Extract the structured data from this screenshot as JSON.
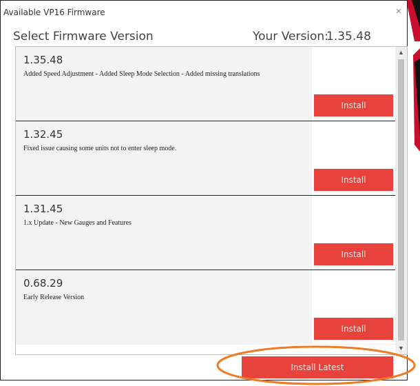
{
  "window": {
    "title": "Available VP16 Firmware",
    "close_glyph": "×"
  },
  "header": {
    "title": "Select Firmware Version",
    "your_version_label": "Your Version:",
    "your_version_value": "1.35.48"
  },
  "firmware_list": [
    {
      "version": "1.35.48",
      "description": "Added Speed Adjustment - Added Sleep Mode Selection - Added missing translations",
      "install_label": "Install"
    },
    {
      "version": "1.32.45",
      "description": "Fixed issue causing some units not to enter sleep mode.",
      "install_label": "Install"
    },
    {
      "version": "1.31.45",
      "description": "1.x Update - New Gauges and Features",
      "install_label": "Install"
    },
    {
      "version": "0.68.29",
      "description": "Early Release Version",
      "install_label": "Install"
    }
  ],
  "footer": {
    "install_latest_label": "Install Latest"
  },
  "colors": {
    "accent": "#e8423c",
    "highlight": "#f07b22"
  },
  "icons": {
    "close": "close-icon",
    "scroll_up": "chevron-up-icon",
    "scroll_down": "chevron-down-icon"
  }
}
